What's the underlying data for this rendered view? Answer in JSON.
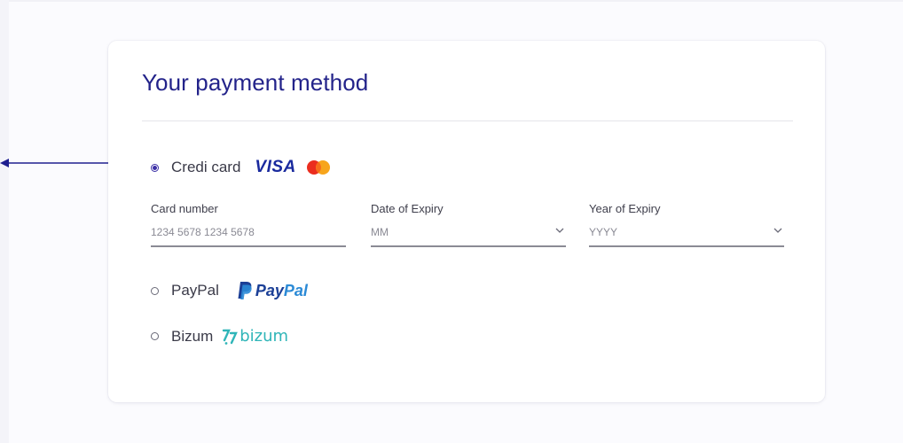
{
  "card": {
    "title": "Your payment method"
  },
  "payment_options": {
    "credit_card": {
      "label": "Credi card",
      "selected": true,
      "brands": {
        "visa": "VISA",
        "mastercard_icon": "mastercard-icon"
      }
    },
    "paypal": {
      "label": "PayPal",
      "selected": false,
      "logo_text_pay": "Pay",
      "logo_text_pal": "Pal"
    },
    "bizum": {
      "label": "Bizum",
      "selected": false,
      "logo_text": "bizum"
    }
  },
  "card_fields": {
    "card_number": {
      "label": "Card number",
      "placeholder": "1234 5678 1234 5678",
      "value": ""
    },
    "expiry_month": {
      "label": "Date of Expiry",
      "selected_value": "MM"
    },
    "expiry_year": {
      "label": "Year of Expiry",
      "selected_value": "YYYY"
    }
  },
  "colors": {
    "title": "#23238a",
    "radio_checked": "#3b2fa6",
    "visa": "#1a2a9e",
    "paypal_dark": "#1b3f96",
    "paypal_light": "#2b8ad6",
    "bizum": "#2fb5b8",
    "arrow": "#1f1f8f"
  }
}
